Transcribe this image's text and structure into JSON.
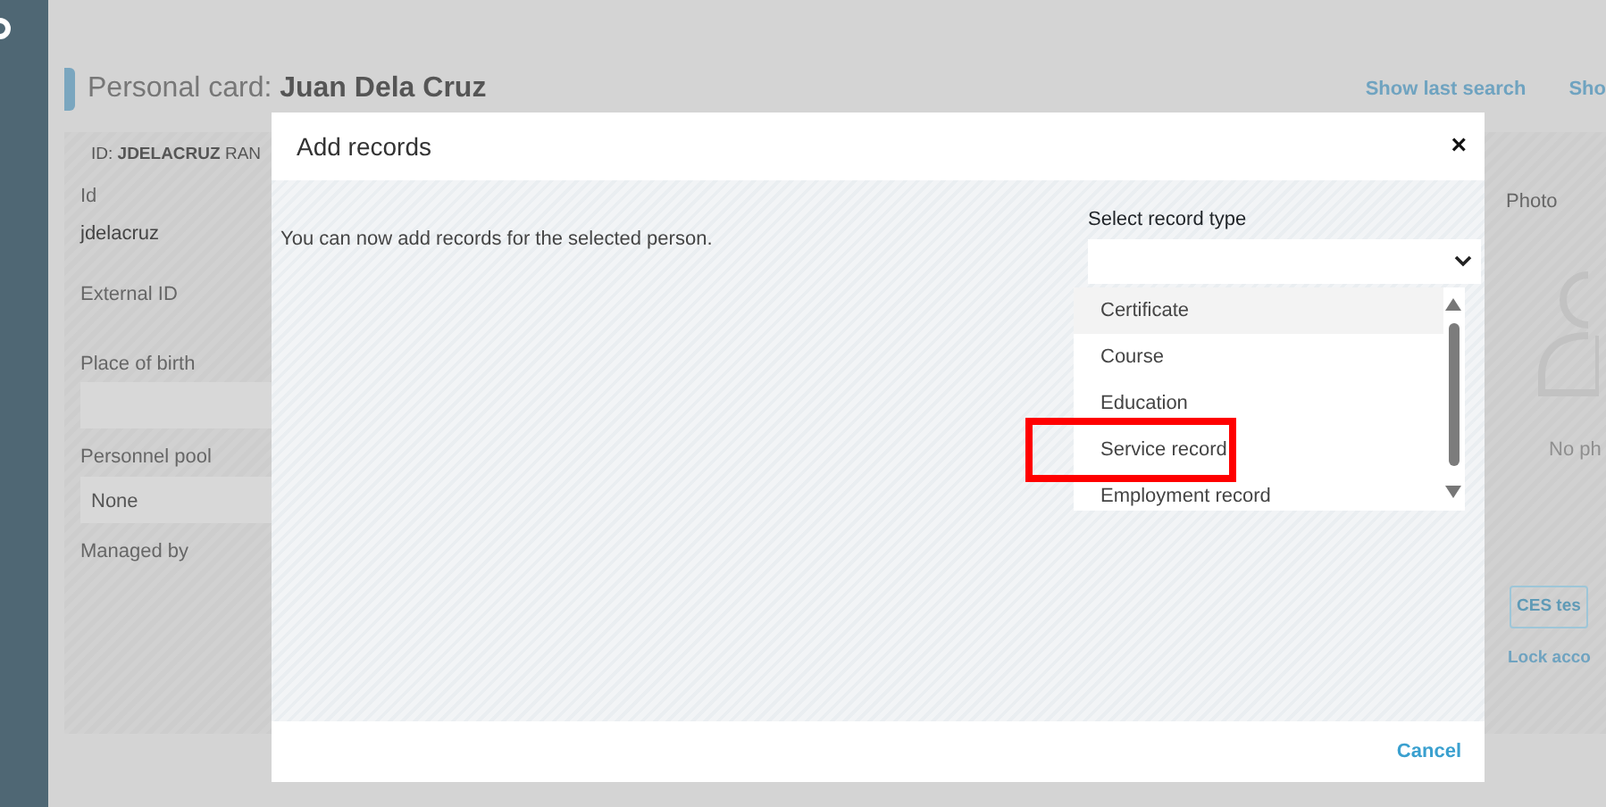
{
  "header": {
    "title_prefix": "Personal card:",
    "title_name": "Juan Dela Cruz",
    "links": [
      "Show last search",
      "Sho"
    ]
  },
  "card": {
    "id_line": "ID: **JDELACRUZ** RAN",
    "fields": [
      {
        "kind": "text",
        "label": "Id",
        "value": "jdelacruz"
      },
      {
        "kind": "text",
        "label": "External ID"
      },
      {
        "kind": "input",
        "label": "Place of birth"
      },
      {
        "kind": "input",
        "label": "Personnel pool",
        "value": "None"
      },
      {
        "kind": "text",
        "label": "Managed by"
      }
    ],
    "photo": {
      "label": "Photo",
      "caption": "No ph"
    },
    "button": "CES tes",
    "link": "Lock acco"
  },
  "modal": {
    "title": "Add records",
    "close": "×",
    "message": "You can now add records for the selected person.",
    "select": {
      "label": "Select record type",
      "expanded": true,
      "options": [
        {
          "label": "Certificate",
          "highlighted": true,
          "annotated": false
        },
        {
          "label": "Course",
          "highlighted": false,
          "annotated": false
        },
        {
          "label": "Education",
          "highlighted": false,
          "annotated": false
        },
        {
          "label": "Service record",
          "highlighted": false,
          "annotated": true
        },
        {
          "label": "Employment record",
          "highlighted": false,
          "annotated": false
        }
      ]
    },
    "cancel": "Cancel"
  }
}
